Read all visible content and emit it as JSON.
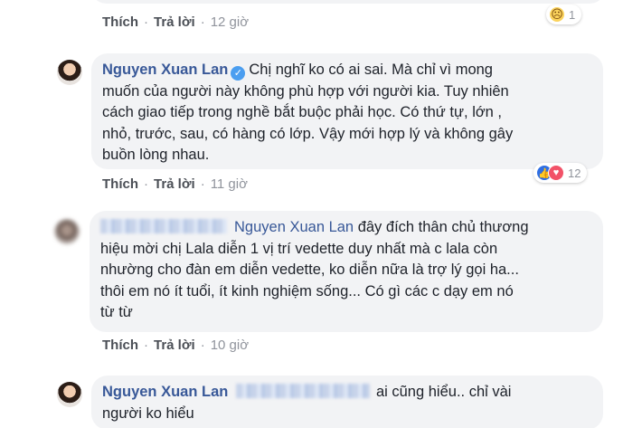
{
  "actions": {
    "like": "Thích",
    "reply": "Trả lời",
    "separator": "·"
  },
  "comments": [
    {
      "time": "12 giờ",
      "reaction_count": "1",
      "reaction_icon": "sad-face-icon"
    },
    {
      "author": "Nguyen Xuan Lan",
      "verified": true,
      "lines": [
        "Chị nghĩ ko có ai sai. Mà chỉ vì mong",
        "muốn của người này không phù hợp với người kia. Tuy nhiên",
        "cách giao tiếp trong nghề bắt buộc phải học. Có thứ tự, lớn ,",
        "nhỏ, trước, sau, có hàng có lớp. Vậy mới hợp lý và không gây",
        "buồn lòng nhau."
      ],
      "time": "11 giờ",
      "reaction_count": "12"
    },
    {
      "tag": "Nguyen Xuan Lan",
      "lines": [
        "đây đích thân chủ thương",
        "hiệu mời chị Lala diễn 1 vị trí vedette duy nhất mà c lala còn",
        "nhường cho đàn em diễn vedette, ko diễn nữa là trợ lý gọi ha...",
        "thôi em nó ít tuổi, ít kinh nghiệm sống... Có gì các c dạy em nó",
        "từ từ"
      ],
      "time": "10 giờ"
    },
    {
      "author": "Nguyen Xuan Lan",
      "lines": [
        "ai cũng hiểu.. chỉ vài",
        "người ko hiểu"
      ]
    }
  ]
}
